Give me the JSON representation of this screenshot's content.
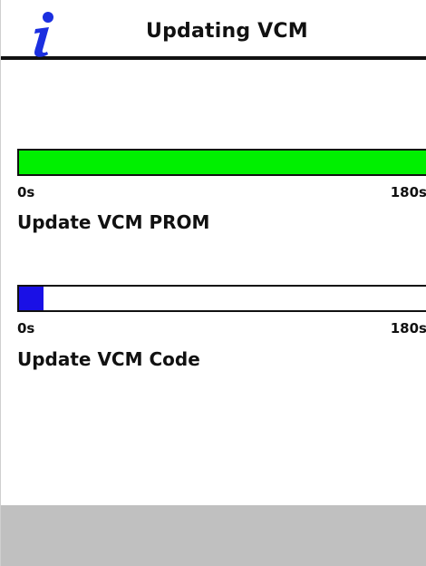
{
  "window": {
    "title": "Updating VCM",
    "icon": "info-icon",
    "icon_color": "#1b2fe0"
  },
  "progress_items": [
    {
      "label": "Update VCM PROM",
      "progress_fraction": 1.0,
      "fill_color": "#00f000",
      "range_start_label": "0s",
      "range_end_label": "180s"
    },
    {
      "label": "Update VCM Code",
      "progress_fraction": 0.06,
      "fill_color": "#1a10e6",
      "range_start_label": "0s",
      "range_end_label": "180s"
    }
  ],
  "footer": {
    "color": "#c0c0c0"
  }
}
